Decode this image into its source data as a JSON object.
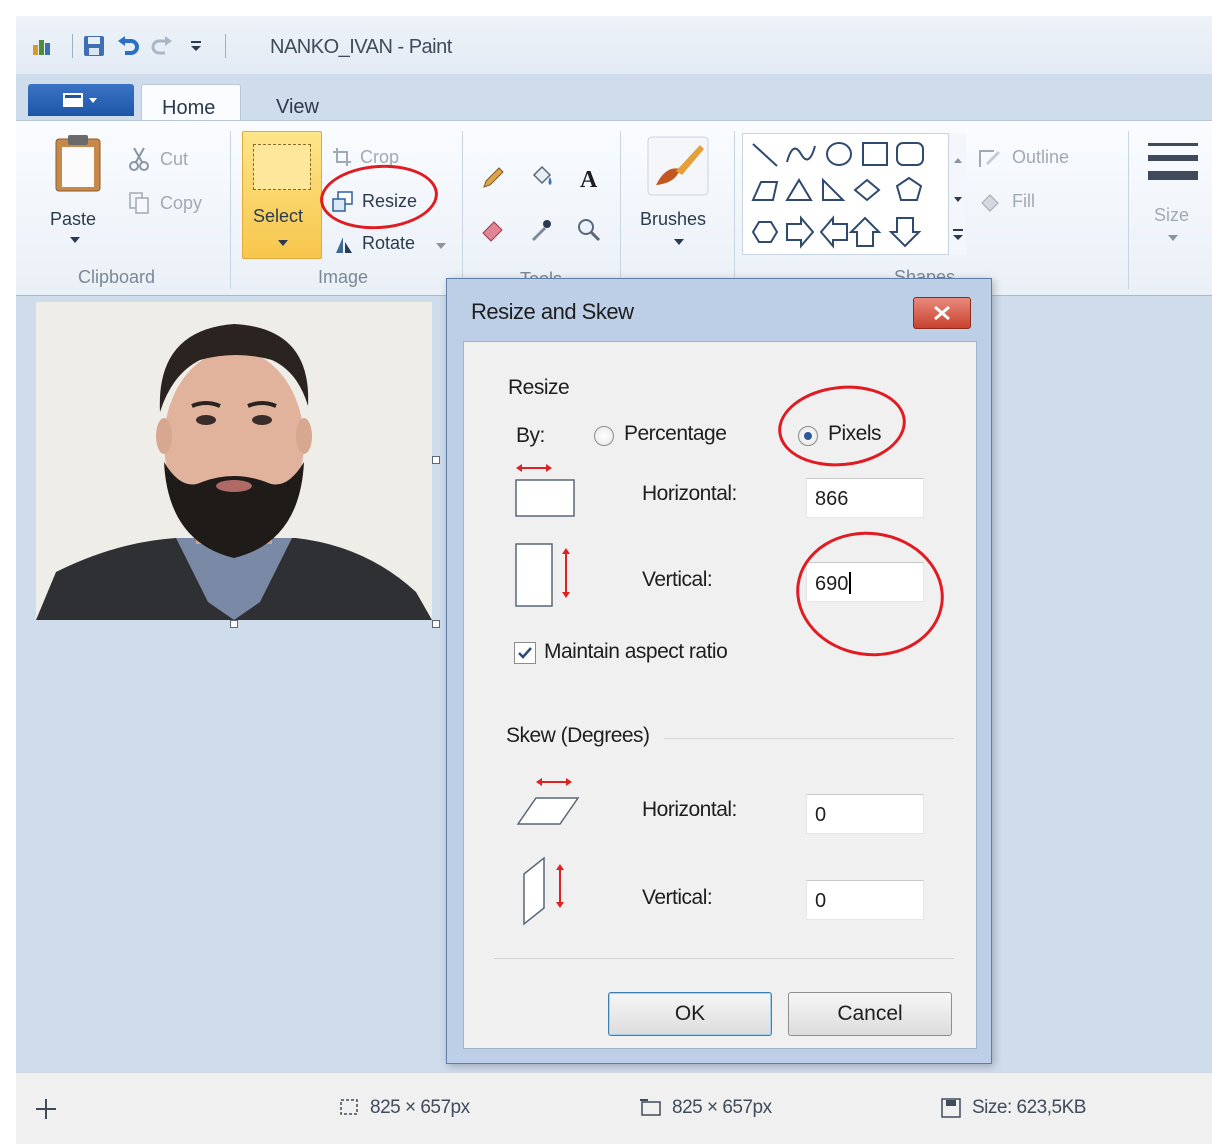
{
  "window": {
    "title": "NANKO_IVAN - Paint"
  },
  "tabs": {
    "home": "Home",
    "view": "View"
  },
  "ribbon": {
    "clipboard": {
      "paste": "Paste",
      "cut": "Cut",
      "copy": "Copy",
      "label": "Clipboard"
    },
    "image": {
      "select": "Select",
      "crop": "Crop",
      "resize": "Resize",
      "rotate": "Rotate",
      "label": "Image"
    },
    "tools": {
      "label": "Tools"
    },
    "brushes": {
      "label": "Brushes"
    },
    "shapes": {
      "outline": "Outline",
      "fill": "Fill",
      "label": "Shapes"
    },
    "size": {
      "label": "Size"
    }
  },
  "dialog": {
    "title": "Resize and Skew",
    "resize_section": "Resize",
    "by_label": "By:",
    "percentage_label": "Percentage",
    "pixels_label": "Pixels",
    "selected_unit": "Pixels",
    "horizontal_label": "Horizontal:",
    "horizontal_value": "866",
    "vertical_label": "Vertical:",
    "vertical_value": "690",
    "maintain_aspect": "Maintain aspect ratio",
    "maintain_aspect_checked": true,
    "skew_section": "Skew (Degrees)",
    "skew_horizontal_label": "Horizontal:",
    "skew_horizontal_value": "0",
    "skew_vertical_label": "Vertical:",
    "skew_vertical_value": "0",
    "ok": "OK",
    "cancel": "Cancel"
  },
  "status": {
    "selection_size": "825 × 657px",
    "image_size": "825 × 657px",
    "file_size": "Size: 623,5KB"
  },
  "colors": {
    "annotation_red": "#e01b22",
    "file_tab_blue": "#1d56a8",
    "select_yellow": "#f7c64c"
  }
}
